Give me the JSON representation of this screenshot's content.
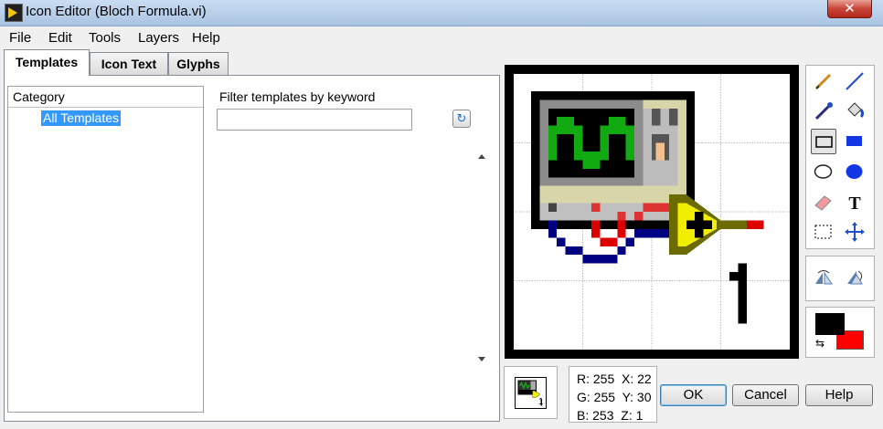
{
  "window": {
    "title": "Icon Editor (Bloch Formula.vi)",
    "close_glyph": "✕"
  },
  "menu": [
    "File",
    "Edit",
    "Tools",
    "Layers",
    "Help"
  ],
  "tabs": [
    {
      "label": "Templates",
      "active": true
    },
    {
      "label": "Icon Text",
      "active": false
    },
    {
      "label": "Glyphs",
      "active": false
    }
  ],
  "templates": {
    "category_header": "Category",
    "category_items": [
      "All Templates"
    ],
    "filter_label": "Filter templates by keyword",
    "filter_value": "",
    "refresh_icon": "refresh-icon"
  },
  "tools": {
    "icons": [
      "pencil-icon",
      "line-icon",
      "color-picker-icon",
      "fill-icon",
      "rectangle-icon",
      "filled-rectangle-icon",
      "ellipse-icon",
      "filled-ellipse-icon",
      "eraser-icon",
      "text-icon",
      "select-icon",
      "move-icon",
      "flip-horizontal-icon",
      "rotate-icon"
    ],
    "selected": "rectangle-icon"
  },
  "colors": {
    "foreground": "#000000",
    "background": "#ff0000",
    "accent_selection": "#3399ff"
  },
  "status": {
    "r": "R: 255",
    "g": "G: 255",
    "b": "B: 253",
    "x": "X: 22",
    "y": "Y: 30",
    "z": "Z: 1"
  },
  "buttons": {
    "ok": "OK",
    "cancel": "Cancel",
    "help": "Help"
  },
  "icon_glyph_number": "1"
}
